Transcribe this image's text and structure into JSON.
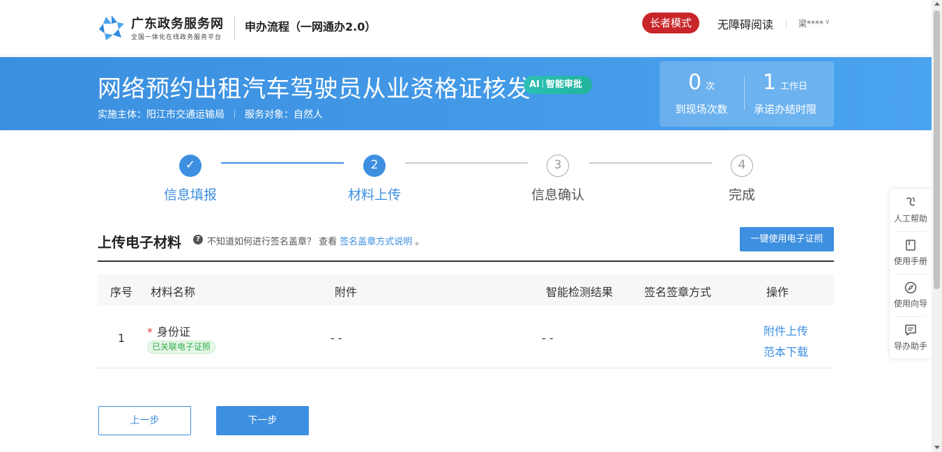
{
  "header": {
    "brand_name": "广东政务服务网",
    "brand_sub": "全国一体化在线政务服务平台",
    "title": "申办流程（一网通办2.0）",
    "elder_mode": "长者模式",
    "accessibility": "无障碍阅读",
    "user": "梁****"
  },
  "banner": {
    "service_title": "网络预约出租汽车驾驶员从业资格证核发",
    "ai_label": "AI",
    "ai_text": "智能审批",
    "authority_label": "实施主体：阳江市交通运输局",
    "target_label": "服务对象：自然人",
    "stat1": {
      "value": "0",
      "unit": "次",
      "label": "到现场次数"
    },
    "stat2": {
      "value": "1",
      "unit": "工作日",
      "label": "承诺办结时限"
    }
  },
  "steps": [
    {
      "num": "✓",
      "label": "信息填报",
      "state": "done"
    },
    {
      "num": "2",
      "label": "材料上传",
      "state": "active"
    },
    {
      "num": "3",
      "label": "信息确认",
      "state": "todo"
    },
    {
      "num": "4",
      "label": "完成",
      "state": "todo"
    }
  ],
  "section": {
    "title": "上传电子材料",
    "help_prefix": "不知道如何进行签名盖章？ 查看 ",
    "help_link": "签名盖章方式说明",
    "help_suffix": " 。",
    "ecert_button": "一键使用电子证照"
  },
  "table": {
    "headers": [
      "序号",
      "材料名称",
      "附件",
      "智能检测结果",
      "签名签章方式",
      "操作"
    ],
    "rows": [
      {
        "index": "1",
        "required": "*",
        "name": "身份证",
        "tag": "已关联电子证照",
        "attachment": "- -",
        "detection": "- -",
        "signature": "",
        "op_upload": "附件上传",
        "op_download": "范本下载"
      }
    ]
  },
  "buttons": {
    "prev": "上一步",
    "next": "下一步"
  },
  "side_tools": [
    {
      "label": "人工帮助",
      "icon": "human-help-icon"
    },
    {
      "label": "使用手册",
      "icon": "manual-book-icon"
    },
    {
      "label": "使用向导",
      "icon": "compass-guide-icon"
    },
    {
      "label": "导办助手",
      "icon": "chat-assistant-icon"
    }
  ],
  "colors": {
    "primary": "#3d8fe0",
    "banner": "#4aa3ee",
    "elder_red": "#c8262a",
    "ai_green": "#21b39b",
    "tag_green": "#2fab4b",
    "required_red": "#e23b3b"
  }
}
